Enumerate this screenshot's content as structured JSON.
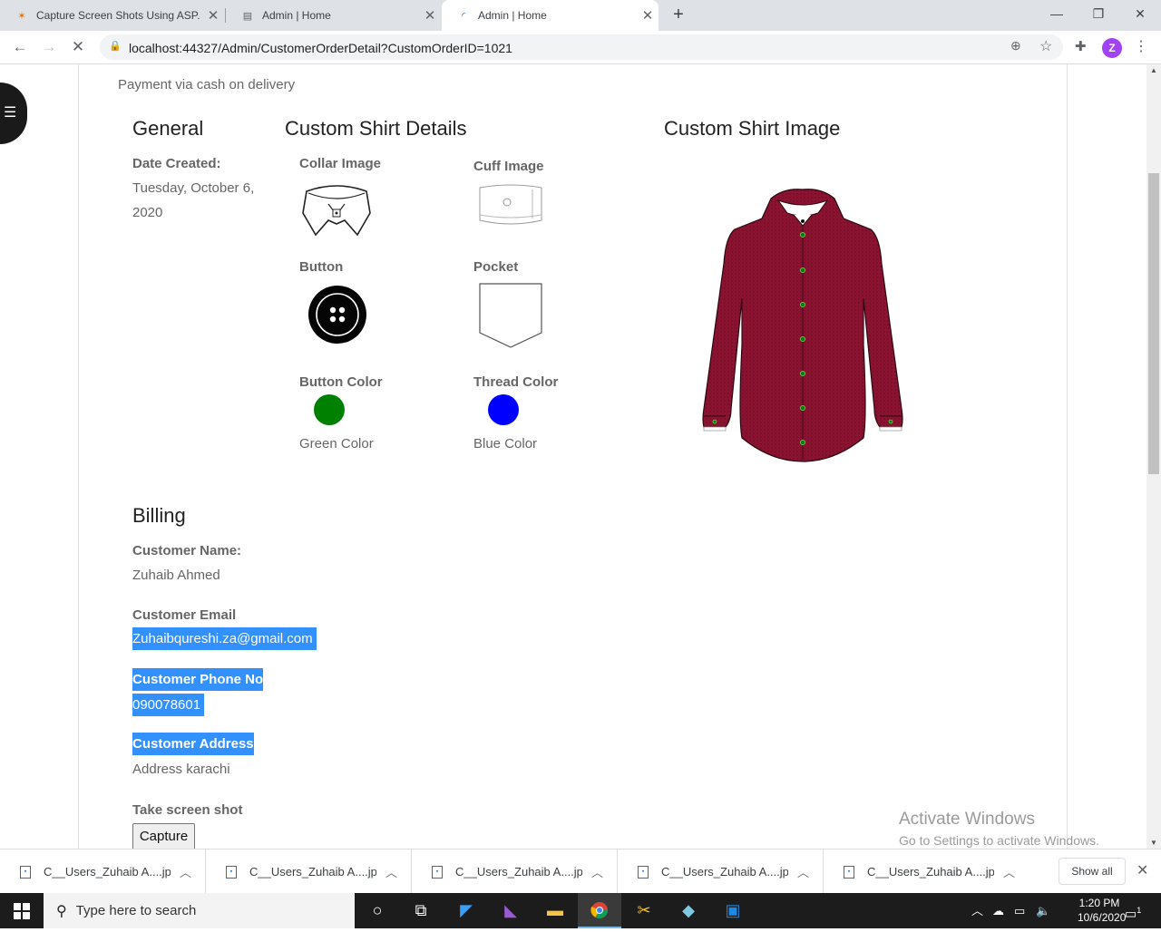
{
  "browser": {
    "tabs": [
      {
        "title": "Capture Screen Shots Using ASP.",
        "icon": "site-favicon"
      },
      {
        "title": "Admin | Home",
        "icon": "page-icon"
      },
      {
        "title": "Admin | Home",
        "icon": "loading-icon"
      }
    ],
    "new_tab": "+",
    "window_controls": {
      "minimize": "—",
      "restore": "❐",
      "close": "✕"
    },
    "url": "localhost:44327/Admin/CustomerOrderDetail?CustomOrderID=1021",
    "avatar_letter": "Z"
  },
  "page": {
    "payment_text": "Payment via cash on delivery",
    "general": {
      "heading": "General",
      "date_label": "Date Created:",
      "date_line1": "Tuesday, October 6,",
      "date_line2": "2020"
    },
    "shirt_details": {
      "heading": "Custom Shirt Details",
      "collar_label": "Collar Image",
      "cuff_label": "Cuff Image",
      "button_label": "Button",
      "pocket_label": "Pocket",
      "button_color_label": "Button Color",
      "thread_color_label": "Thread Color",
      "button_color_name": "Green Color",
      "thread_color_name": "Blue Color",
      "button_color_hex": "#008000",
      "thread_color_hex": "#0000ff"
    },
    "shirt_image": {
      "heading": "Custom Shirt Image",
      "shirt_color": "#8b1230"
    },
    "billing": {
      "heading": "Billing",
      "name_label": "Customer Name:",
      "name_value": "Zuhaib Ahmed",
      "email_label": "Customer Email",
      "email_value": "Zuhaibqureshi.za@gmail.com",
      "phone_label": "Customer Phone No",
      "phone_value": "090078601",
      "address_label": "Customer Address",
      "address_value": "Address karachi"
    },
    "capture": {
      "label": "Take screen shot",
      "button": "Capture"
    },
    "watermark": {
      "line1": "Activate Windows",
      "line2": "Go to Settings to activate Windows."
    },
    "selection_color": "#3390ff"
  },
  "downloads": {
    "items": [
      "C__Users_Zuhaib A....jpg",
      "C__Users_Zuhaib A....jpg",
      "C__Users_Zuhaib A....jpg",
      "C__Users_Zuhaib A....jpg",
      "C__Users_Zuhaib A....jpg"
    ],
    "show_all": "Show all"
  },
  "taskbar": {
    "search_placeholder": "Type here to search",
    "time": "1:20 PM",
    "date": "10/6/2020",
    "notification_count": "1"
  }
}
